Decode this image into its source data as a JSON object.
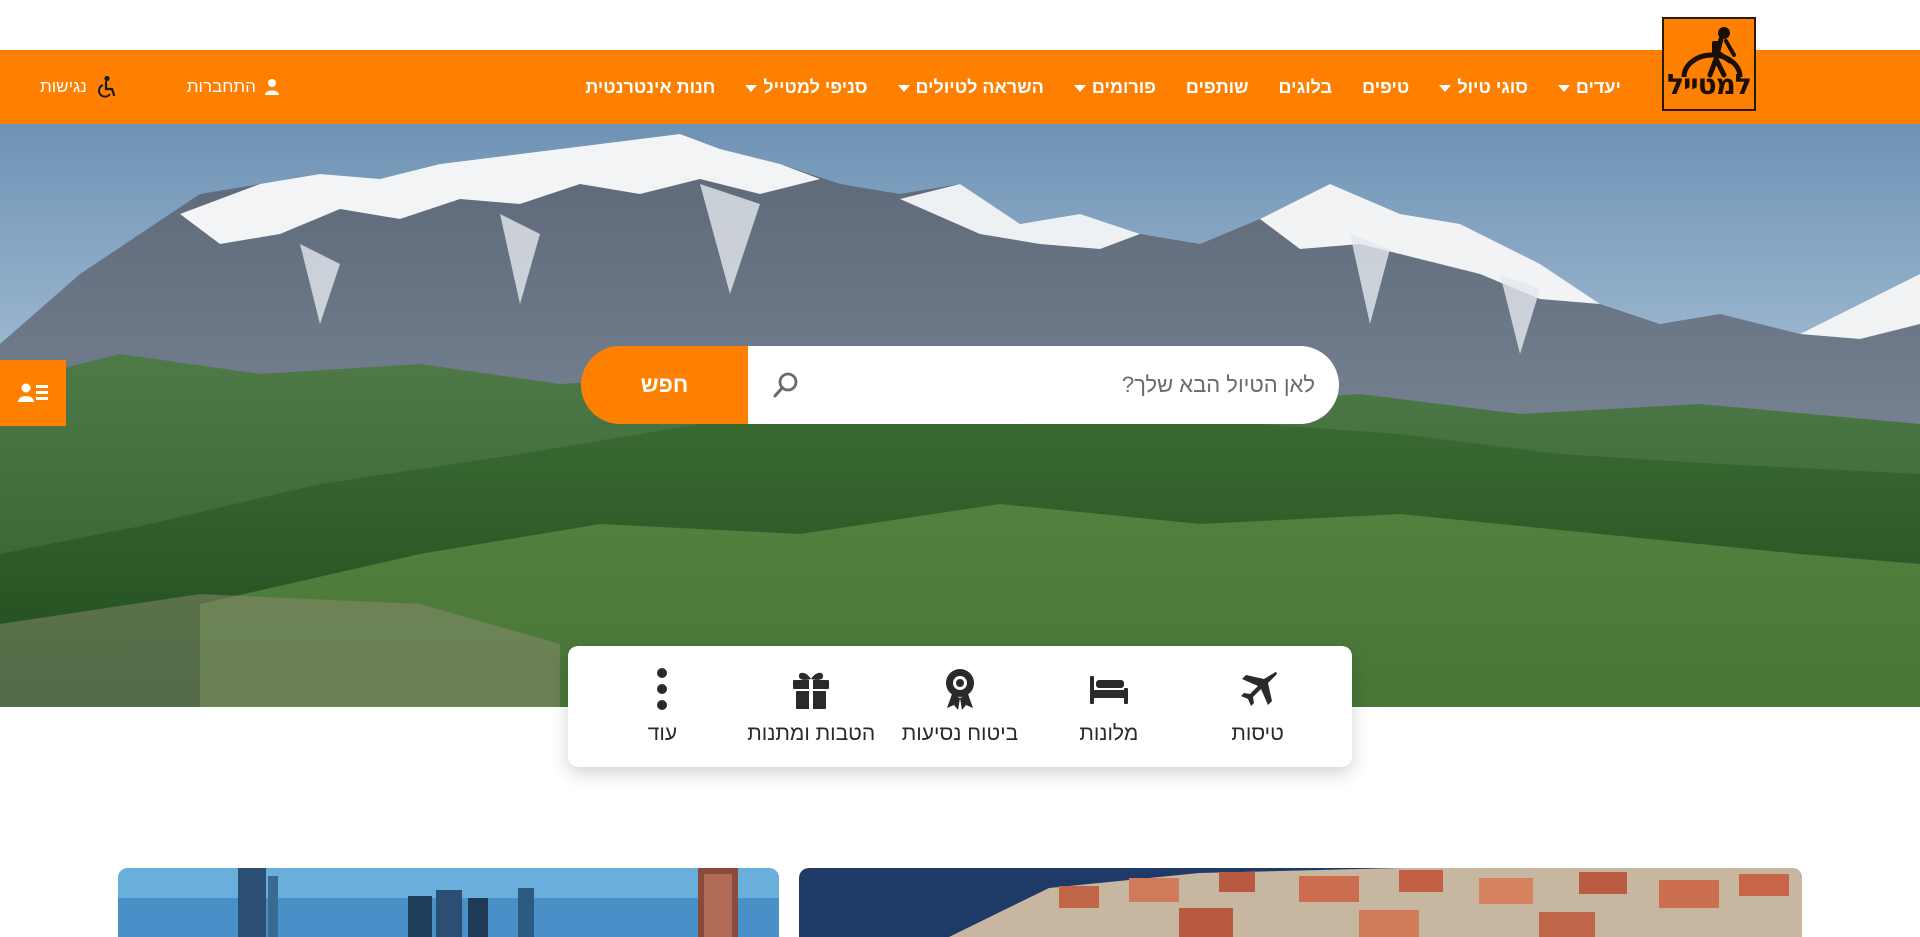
{
  "logo": {
    "text": "למטייל",
    "icon": "hiker-globe-logo"
  },
  "nav": {
    "items": [
      {
        "label": "יעדים",
        "dropdown": true
      },
      {
        "label": "סוגי טיול",
        "dropdown": true
      },
      {
        "label": "טיפים",
        "dropdown": false
      },
      {
        "label": "בלוגים",
        "dropdown": false
      },
      {
        "label": "שותפים",
        "dropdown": false
      },
      {
        "label": "פורומים",
        "dropdown": true
      },
      {
        "label": "השראה לטיולים",
        "dropdown": true
      },
      {
        "label": "סניפי למטייל",
        "dropdown": true
      },
      {
        "label": "חנות אינטרנטית",
        "dropdown": false
      }
    ],
    "login_label": "התחברות",
    "accessibility_label": "נגישות"
  },
  "search": {
    "placeholder": "לאן הטיול הבא שלך?",
    "button_label": "חפש"
  },
  "categories": [
    {
      "label": "טיסות",
      "icon": "airplane-icon"
    },
    {
      "label": "מלונות",
      "icon": "bed-icon"
    },
    {
      "label": "ביטוח נסיעות",
      "icon": "award-icon"
    },
    {
      "label": "הטבות ומתנות",
      "icon": "gift-icon"
    },
    {
      "label": "עוד",
      "icon": "more-vertical-icon"
    }
  ],
  "colors": {
    "brand_orange": "#ff8000",
    "text_dark": "#2a2a2a"
  }
}
